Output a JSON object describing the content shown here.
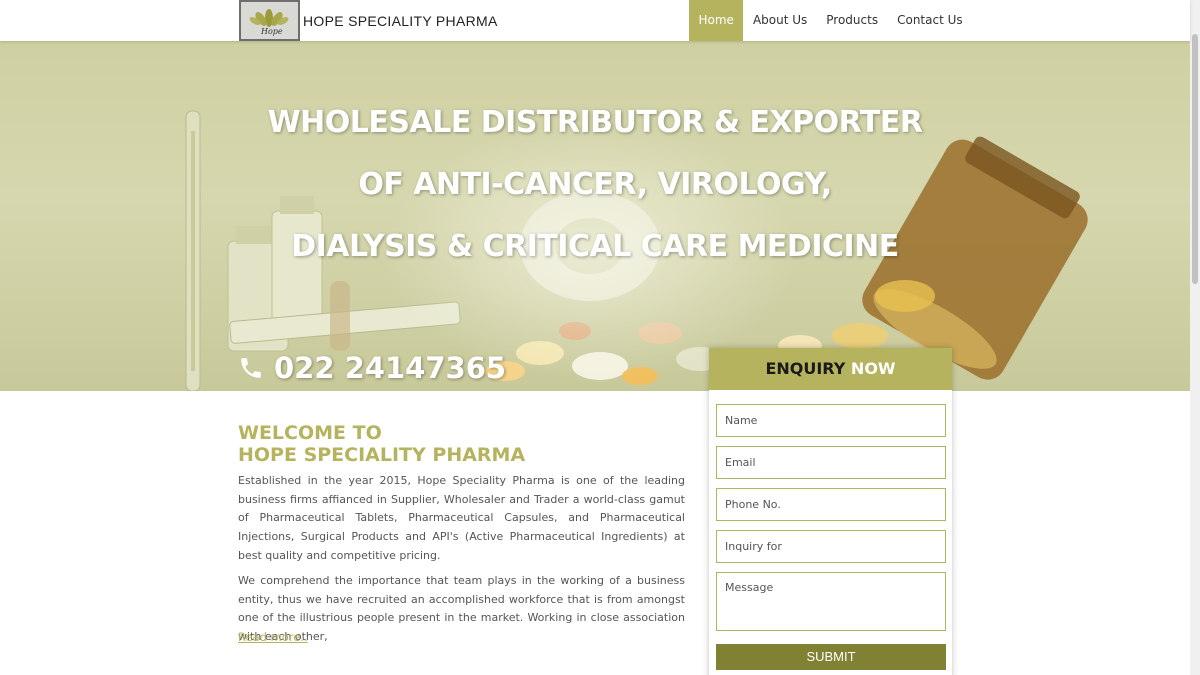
{
  "brand": {
    "logo_script": "Hope",
    "name": "HOPE SPECIALITY PHARMA"
  },
  "nav": {
    "items": [
      "Home",
      "About Us",
      "Products",
      "Contact Us"
    ],
    "active": "Home"
  },
  "hero": {
    "lines": [
      "WHOLESALE DISTRIBUTOR & EXPORTER",
      "OF ANTI-CANCER, VIROLOGY,",
      "DIALYSIS & CRITICAL CARE MEDICINE"
    ],
    "phone": "022 24147365"
  },
  "welcome": {
    "title_line1": "WELCOME TO",
    "title_line2": "HOPE SPECIALITY PHARMA",
    "para1": "Established in the year 2015, Hope Speciality Pharma is one of the leading business firms affianced in Supplier, Wholesaler and Trader a world-class gamut of Pharmaceutical Tablets, Pharmaceutical Capsules, and Pharmaceutical Injections, Surgical Products and API's (Active Pharmaceutical Ingredients) at best quality and competitive pricing.",
    "para2": "We comprehend the importance that team plays in the working of a business entity, thus we have recruited an accomplished workforce that is from amongst one of the illustrious people present in the market. Working in close association with each other,",
    "read_more": "Read more.."
  },
  "enquiry": {
    "title": "ENQUIRY",
    "title_accent": "NOW",
    "fields": [
      "Name",
      "Email",
      "Phone No.",
      "Inquiry for"
    ],
    "message": "Message",
    "submit": "SUBMIT"
  },
  "colors": {
    "accent": "#b5b35d",
    "submit": "#818134"
  },
  "icons": {
    "phone": "phone-icon"
  }
}
